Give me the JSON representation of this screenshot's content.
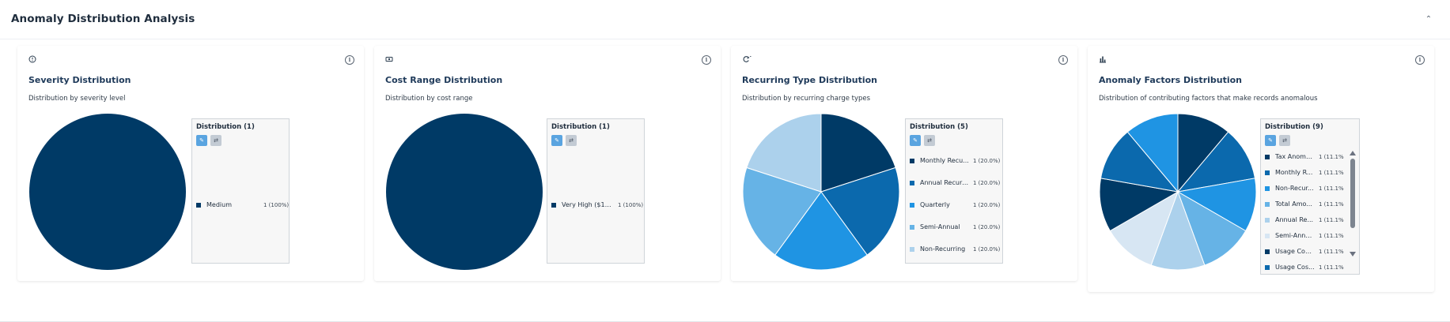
{
  "header": {
    "title": "Anomaly Distribution Analysis",
    "collapse_icon": "chevron-up-icon"
  },
  "legend_buttons": {
    "edit_icon": "pencil-icon",
    "shuffle_icon": "shuffle-icon"
  },
  "cards": [
    {
      "icon": "alert-circle-icon",
      "title": "Severity Distribution",
      "subtitle": "Distribution by severity level",
      "legend_title": "Distribution (1)",
      "items": [
        {
          "label": "Medium",
          "value": "1 (100%)"
        }
      ]
    },
    {
      "icon": "money-icon",
      "title": "Cost Range Distribution",
      "subtitle": "Distribution by cost range",
      "legend_title": "Distribution (1)",
      "items": [
        {
          "label": "Very High ($10...",
          "value": "1 (100%)"
        }
      ]
    },
    {
      "icon": "refresh-icon",
      "title": "Recurring Type Distribution",
      "subtitle": "Distribution by recurring charge types",
      "legend_title": "Distribution (5)",
      "items": [
        {
          "label": "Monthly Recu...",
          "value": "1 (20.0%)"
        },
        {
          "label": "Annual Recurr...",
          "value": "1 (20.0%)"
        },
        {
          "label": "Quarterly",
          "value": "1 (20.0%)"
        },
        {
          "label": "Semi-Annual",
          "value": "1 (20.0%)"
        },
        {
          "label": "Non-Recurring",
          "value": "1 (20.0%)"
        }
      ]
    },
    {
      "icon": "bar-chart-icon",
      "title": "Anomaly Factors Distribution",
      "subtitle": "Distribution of contributing factors that make records anomalous",
      "legend_title": "Distribution (9)",
      "items": [
        {
          "label": "Tax Anoma...",
          "value": "1 (11.1%"
        },
        {
          "label": "Monthly R...",
          "value": "1 (11.1%"
        },
        {
          "label": "Non-Recur...",
          "value": "1 (11.1%"
        },
        {
          "label": "Total Amo...",
          "value": "1 (11.1%"
        },
        {
          "label": "Annual Re...",
          "value": "1 (11.1%"
        },
        {
          "label": "Semi-Annu...",
          "value": "1 (11.1%"
        },
        {
          "label": "Usage Cou...",
          "value": "1 (11.1%"
        },
        {
          "label": "Usage Cos...",
          "value": "1 (11.1%"
        }
      ]
    }
  ],
  "pies": [
    {
      "slices": [
        {
          "value": 1,
          "color": "#003a66"
        }
      ]
    },
    {
      "slices": [
        {
          "value": 1,
          "color": "#003a66"
        }
      ]
    },
    {
      "slices": [
        {
          "value": 1,
          "color": "#003a66"
        },
        {
          "value": 1,
          "color": "#0b69ad"
        },
        {
          "value": 1,
          "color": "#1f94e3"
        },
        {
          "value": 1,
          "color": "#66b3e6"
        },
        {
          "value": 1,
          "color": "#acd1ec"
        }
      ]
    },
    {
      "slices": [
        {
          "value": 1,
          "color": "#003a66"
        },
        {
          "value": 1,
          "color": "#0b69ad"
        },
        {
          "value": 1,
          "color": "#1f94e3"
        },
        {
          "value": 1,
          "color": "#66b3e6"
        },
        {
          "value": 1,
          "color": "#acd1ec"
        },
        {
          "value": 1,
          "color": "#d7e6f3"
        },
        {
          "value": 1,
          "color": "#003a66"
        },
        {
          "value": 1,
          "color": "#0b69ad"
        },
        {
          "value": 1,
          "color": "#1f94e3"
        }
      ]
    }
  ],
  "legend_colors": [
    [
      "#003a66"
    ],
    [
      "#003a66"
    ],
    [
      "#003a66",
      "#0b69ad",
      "#1f94e3",
      "#66b3e6",
      "#acd1ec"
    ],
    [
      "#003a66",
      "#0b69ad",
      "#1f94e3",
      "#66b3e6",
      "#acd1ec",
      "#d7e6f3",
      "#003a66",
      "#0b69ad"
    ]
  ]
}
